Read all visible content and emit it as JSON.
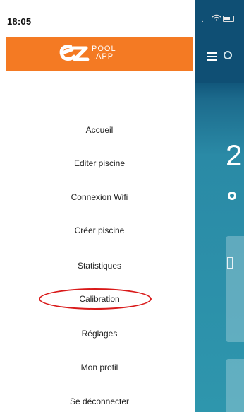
{
  "status_bar": {
    "time": "18:05"
  },
  "brand": {
    "logo_line1": "POOL",
    "logo_line2": ".APP"
  },
  "menu": {
    "items": [
      {
        "label": "Accueil"
      },
      {
        "label": "Editer piscine"
      },
      {
        "label": "Connexion Wifi"
      },
      {
        "label": "Créer piscine"
      },
      {
        "label": "Statistiques"
      },
      {
        "label": "Calibration"
      },
      {
        "label": "Réglages"
      },
      {
        "label": "Mon profil"
      },
      {
        "label": "Se déconnecter"
      }
    ],
    "highlighted_item": "Calibration"
  },
  "background_app": {
    "big_value": "2"
  },
  "colors": {
    "brand_orange": "#f47a23",
    "highlight_red": "#d91a1a",
    "app_blue": "#0f4f74",
    "app_teal": "#2e96ad"
  }
}
